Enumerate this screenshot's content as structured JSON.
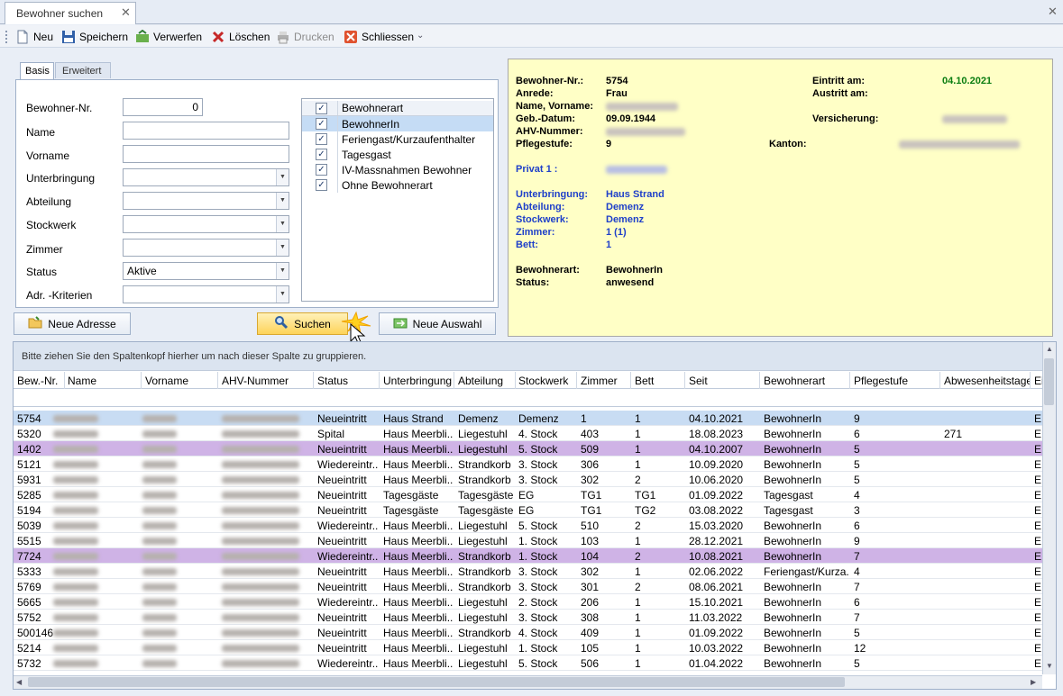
{
  "tab": {
    "title": "Bewohner suchen",
    "close": "✕"
  },
  "window_close": "✕",
  "toolbar": {
    "new": "Neu",
    "save": "Speichern",
    "discard": "Verwerfen",
    "delete": "Löschen",
    "print": "Drucken",
    "close": "Schliessen",
    "overflow": "⌄"
  },
  "search": {
    "tabs": [
      "Basis",
      "Erweitert"
    ],
    "fields": {
      "bewohner_nr": {
        "label": "Bewohner-Nr.",
        "value": "0"
      },
      "name": {
        "label": "Name",
        "value": ""
      },
      "vorname": {
        "label": "Vorname",
        "value": ""
      },
      "unterbringung": {
        "label": "Unterbringung",
        "value": ""
      },
      "abteilung": {
        "label": "Abteilung",
        "value": ""
      },
      "stockwerk": {
        "label": "Stockwerk",
        "value": ""
      },
      "zimmer": {
        "label": "Zimmer",
        "value": ""
      },
      "status": {
        "label": "Status",
        "value": "Aktive"
      },
      "adr_kriterien": {
        "label": "Adr. -Kriterien",
        "value": ""
      }
    },
    "checklist": {
      "header": "Bewohnerart",
      "items": [
        {
          "label": "BewohnerIn",
          "checked": true
        },
        {
          "label": "Feriengast/Kurzaufenthalter",
          "checked": true
        },
        {
          "label": "Tagesgast",
          "checked": true
        },
        {
          "label": "IV-Massnahmen Bewohner",
          "checked": true
        },
        {
          "label": "Ohne Bewohnerart",
          "checked": true
        }
      ]
    },
    "buttons": {
      "new_address": "Neue Adresse",
      "search": "Suchen",
      "new_selection": "Neue Auswahl"
    }
  },
  "info": {
    "labels": {
      "nr": "Bewohner-Nr.:",
      "anrede": "Anrede:",
      "name": "Name, Vorname:",
      "geb": "Geb.-Datum:",
      "ahv": "AHV-Nummer:",
      "pflege": "Pflegestufe:",
      "privat": "Privat 1 :",
      "unterbringung": "Unterbringung:",
      "abteilung": "Abteilung:",
      "stockwerk": "Stockwerk:",
      "zimmer": "Zimmer:",
      "bett": "Bett:",
      "bewohnerart": "Bewohnerart:",
      "status": "Status:",
      "eintritt": "Eintritt am:",
      "austritt": "Austritt am:",
      "versicherung": "Versicherung:",
      "kanton": "Kanton:"
    },
    "values": {
      "nr": "5754",
      "anrede": "Frau",
      "geb": "09.09.1944",
      "pflege": "9",
      "unterbringung": "Haus Strand",
      "abteilung": "Demenz",
      "stockwerk": "Demenz",
      "zimmer": "1 (1)",
      "bett": "1",
      "bewohnerart": "BewohnerIn",
      "status": "anwesend",
      "eintritt": "04.10.2021"
    }
  },
  "grid": {
    "group_hint": "Bitte ziehen Sie den Spaltenkopf hierher um nach dieser Spalte zu gruppieren.",
    "columns": [
      "Bew.-Nr.",
      "Name",
      "Vorname",
      "AHV-Nummer",
      "Status",
      "Unterbringung",
      "Abteilung",
      "Stockwerk",
      "Zimmer",
      "Bett",
      "Seit",
      "Bewohnerart",
      "Pflegestufe",
      "Abwesenheitstage",
      "Ei"
    ],
    "rows": [
      {
        "nr": "5754",
        "status": "Neueintritt",
        "unterbringung": "Haus Strand",
        "abteilung": "Demenz",
        "stockwerk": "Demenz",
        "zimmer": "1",
        "bett": "1",
        "seit": "04.10.2021",
        "art": "BewohnerIn",
        "pflege": "9",
        "abw": "",
        "e": "E",
        "style": "sel"
      },
      {
        "nr": "5320",
        "status": "Spital",
        "unterbringung": "Haus Meerbli...",
        "abteilung": "Liegestuhl",
        "stockwerk": "4. Stock",
        "zimmer": "403",
        "bett": "1",
        "seit": "18.08.2023",
        "art": "BewohnerIn",
        "pflege": "6",
        "abw": "271",
        "e": "E",
        "style": ""
      },
      {
        "nr": "1402",
        "status": "Neueintritt",
        "unterbringung": "Haus Meerbli...",
        "abteilung": "Liegestuhl",
        "stockwerk": "5. Stock",
        "zimmer": "509",
        "bett": "1",
        "seit": "04.10.2007",
        "art": "BewohnerIn",
        "pflege": "5",
        "abw": "",
        "e": "E",
        "style": "purple"
      },
      {
        "nr": "5121",
        "status": "Wiedereintr...",
        "unterbringung": "Haus Meerbli...",
        "abteilung": "Strandkorb",
        "stockwerk": "3. Stock",
        "zimmer": "306",
        "bett": "1",
        "seit": "10.09.2020",
        "art": "BewohnerIn",
        "pflege": "5",
        "abw": "",
        "e": "E",
        "style": ""
      },
      {
        "nr": "5931",
        "status": "Neueintritt",
        "unterbringung": "Haus Meerbli...",
        "abteilung": "Strandkorb",
        "stockwerk": "3. Stock",
        "zimmer": "302",
        "bett": "2",
        "seit": "10.06.2020",
        "art": "BewohnerIn",
        "pflege": "5",
        "abw": "",
        "e": "E",
        "style": ""
      },
      {
        "nr": "5285",
        "status": "Neueintritt",
        "unterbringung": "Tagesgäste",
        "abteilung": "Tagesgäste",
        "stockwerk": "EG",
        "zimmer": "TG1",
        "bett": "TG1",
        "seit": "01.09.2022",
        "art": "Tagesgast",
        "pflege": "4",
        "abw": "",
        "e": "E",
        "style": ""
      },
      {
        "nr": "5194",
        "status": "Neueintritt",
        "unterbringung": "Tagesgäste",
        "abteilung": "Tagesgäste",
        "stockwerk": "EG",
        "zimmer": "TG1",
        "bett": "TG2",
        "seit": "03.08.2022",
        "art": "Tagesgast",
        "pflege": "3",
        "abw": "",
        "e": "E",
        "style": ""
      },
      {
        "nr": "5039",
        "status": "Wiedereintr...",
        "unterbringung": "Haus Meerbli...",
        "abteilung": "Liegestuhl",
        "stockwerk": "5. Stock",
        "zimmer": "510",
        "bett": "2",
        "seit": "15.03.2020",
        "art": "BewohnerIn",
        "pflege": "6",
        "abw": "",
        "e": "E",
        "style": ""
      },
      {
        "nr": "5515",
        "status": "Neueintritt",
        "unterbringung": "Haus Meerbli...",
        "abteilung": "Liegestuhl",
        "stockwerk": "1. Stock",
        "zimmer": "103",
        "bett": "1",
        "seit": "28.12.2021",
        "art": "BewohnerIn",
        "pflege": "9",
        "abw": "",
        "e": "E",
        "style": ""
      },
      {
        "nr": "7724",
        "status": "Wiedereintr...",
        "unterbringung": "Haus Meerbli...",
        "abteilung": "Strandkorb",
        "stockwerk": "1. Stock",
        "zimmer": "104",
        "bett": "2",
        "seit": "10.08.2021",
        "art": "BewohnerIn",
        "pflege": "7",
        "abw": "",
        "e": "E",
        "style": "purple"
      },
      {
        "nr": "5333",
        "status": "Neueintritt",
        "unterbringung": "Haus Meerbli...",
        "abteilung": "Strandkorb",
        "stockwerk": "3. Stock",
        "zimmer": "302",
        "bett": "1",
        "seit": "02.06.2022",
        "art": "Feriengast/Kurza...",
        "pflege": "4",
        "abw": "",
        "e": "E",
        "style": ""
      },
      {
        "nr": "5769",
        "status": "Neueintritt",
        "unterbringung": "Haus Meerbli...",
        "abteilung": "Strandkorb",
        "stockwerk": "3. Stock",
        "zimmer": "301",
        "bett": "2",
        "seit": "08.06.2021",
        "art": "BewohnerIn",
        "pflege": "7",
        "abw": "",
        "e": "E",
        "style": ""
      },
      {
        "nr": "5665",
        "status": "Wiedereintr...",
        "unterbringung": "Haus Meerbli...",
        "abteilung": "Liegestuhl",
        "stockwerk": "2. Stock",
        "zimmer": "206",
        "bett": "1",
        "seit": "15.10.2021",
        "art": "BewohnerIn",
        "pflege": "6",
        "abw": "",
        "e": "E",
        "style": ""
      },
      {
        "nr": "5752",
        "status": "Neueintritt",
        "unterbringung": "Haus Meerbli...",
        "abteilung": "Liegestuhl",
        "stockwerk": "3. Stock",
        "zimmer": "308",
        "bett": "1",
        "seit": "11.03.2022",
        "art": "BewohnerIn",
        "pflege": "7",
        "abw": "",
        "e": "E",
        "style": ""
      },
      {
        "nr": "500146",
        "status": "Neueintritt",
        "unterbringung": "Haus Meerbli...",
        "abteilung": "Strandkorb",
        "stockwerk": "4. Stock",
        "zimmer": "409",
        "bett": "1",
        "seit": "01.09.2022",
        "art": "BewohnerIn",
        "pflege": "5",
        "abw": "",
        "e": "E",
        "style": ""
      },
      {
        "nr": "5214",
        "status": "Neueintritt",
        "unterbringung": "Haus Meerbli...",
        "abteilung": "Liegestuhl",
        "stockwerk": "1. Stock",
        "zimmer": "105",
        "bett": "1",
        "seit": "10.03.2022",
        "art": "BewohnerIn",
        "pflege": "12",
        "abw": "",
        "e": "E",
        "style": ""
      },
      {
        "nr": "5732",
        "status": "Wiedereintr...",
        "unterbringung": "Haus Meerbli...",
        "abteilung": "Liegestuhl",
        "stockwerk": "5. Stock",
        "zimmer": "506",
        "bett": "1",
        "seit": "01.04.2022",
        "art": "BewohnerIn",
        "pflege": "5",
        "abw": "",
        "e": "E",
        "style": ""
      }
    ]
  }
}
